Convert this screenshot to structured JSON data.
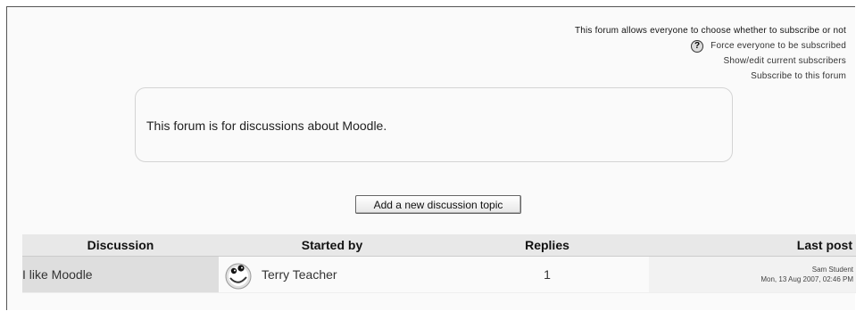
{
  "subscription": {
    "mode_text": "This forum allows everyone to choose whether to subscribe or not",
    "help_symbol": "?",
    "force_link": "Force everyone to be subscribed",
    "show_edit_link": "Show/edit current subscribers",
    "subscribe_link": "Subscribe to this forum"
  },
  "intro": {
    "text": "This forum is for discussions about Moodle."
  },
  "add_button_label": "Add a new discussion topic",
  "table": {
    "headers": {
      "discussion": "Discussion",
      "started_by": "Started by",
      "replies": "Replies",
      "last_post": "Last post"
    },
    "rows": [
      {
        "topic": "I like Moodle",
        "author": "Terry Teacher",
        "replies": "1",
        "last_post_user": "Sam Student",
        "last_post_date": "Mon, 13 Aug 2007, 02:46 PM"
      }
    ]
  },
  "icons": {
    "help": "help-question-icon",
    "avatar": "user-avatar-icon"
  }
}
